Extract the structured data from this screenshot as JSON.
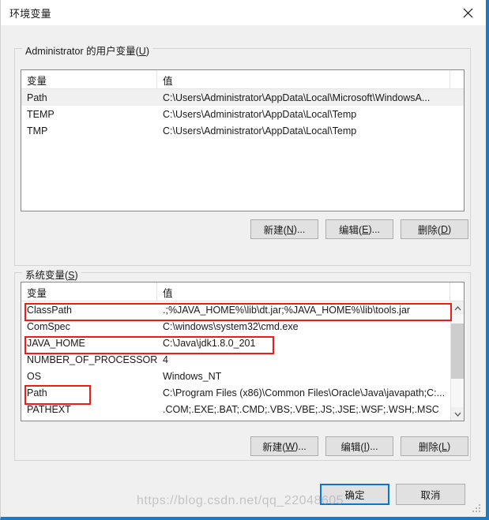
{
  "window": {
    "title": "环境变量",
    "close_icon": "close-icon",
    "accent_color": "#1a7bc4"
  },
  "user_section": {
    "label_prefix": "Administrator 的用户变量(",
    "label_accel": "U",
    "label_suffix": ")",
    "columns": [
      "变量",
      "值"
    ],
    "rows": [
      {
        "name": "Path",
        "value": "C:\\Users\\Administrator\\AppData\\Local\\Microsoft\\WindowsA...",
        "selected": true
      },
      {
        "name": "TEMP",
        "value": "C:\\Users\\Administrator\\AppData\\Local\\Temp",
        "selected": false
      },
      {
        "name": "TMP",
        "value": "C:\\Users\\Administrator\\AppData\\Local\\Temp",
        "selected": false
      }
    ],
    "buttons": [
      {
        "prefix": "新建(",
        "accel": "N",
        "suffix": ")..."
      },
      {
        "prefix": "编辑(",
        "accel": "E",
        "suffix": ")..."
      },
      {
        "prefix": "删除(",
        "accel": "D",
        "suffix": ")"
      }
    ]
  },
  "system_section": {
    "label_prefix": "系统变量(",
    "label_accel": "S",
    "label_suffix": ")",
    "columns": [
      "变量",
      "值"
    ],
    "rows": [
      {
        "name": "ClassPath",
        "value": ".;%JAVA_HOME%\\lib\\dt.jar;%JAVA_HOME%\\lib\\tools.jar"
      },
      {
        "name": "ComSpec",
        "value": "C:\\windows\\system32\\cmd.exe"
      },
      {
        "name": "JAVA_HOME",
        "value": "C:\\Java\\jdk1.8.0_201"
      },
      {
        "name": "NUMBER_OF_PROCESSORS",
        "value": "4"
      },
      {
        "name": "OS",
        "value": "Windows_NT"
      },
      {
        "name": "Path",
        "value": "C:\\Program Files (x86)\\Common Files\\Oracle\\Java\\javapath;C:..."
      },
      {
        "name": "PATHEXT",
        "value": ".COM;.EXE;.BAT;.CMD;.VBS;.VBE;.JS;.JSE;.WSF;.WSH;.MSC"
      }
    ],
    "buttons": [
      {
        "prefix": "新建(",
        "accel": "W",
        "suffix": ")..."
      },
      {
        "prefix": "编辑(",
        "accel": "I",
        "suffix": ")..."
      },
      {
        "prefix": "删除(",
        "accel": "L",
        "suffix": ")"
      }
    ],
    "scrollbar": {
      "up_arrow": "chevron-up-icon",
      "down_arrow": "chevron-down-icon"
    }
  },
  "dialog_buttons": {
    "ok": "确定",
    "cancel": "取消"
  },
  "annotations": {
    "color": "#ee1c17",
    "boxes": [
      "classpath-row",
      "java-home-row",
      "path-name-cell"
    ]
  },
  "watermark": "https://blog.csdn.net/qq_22048605"
}
